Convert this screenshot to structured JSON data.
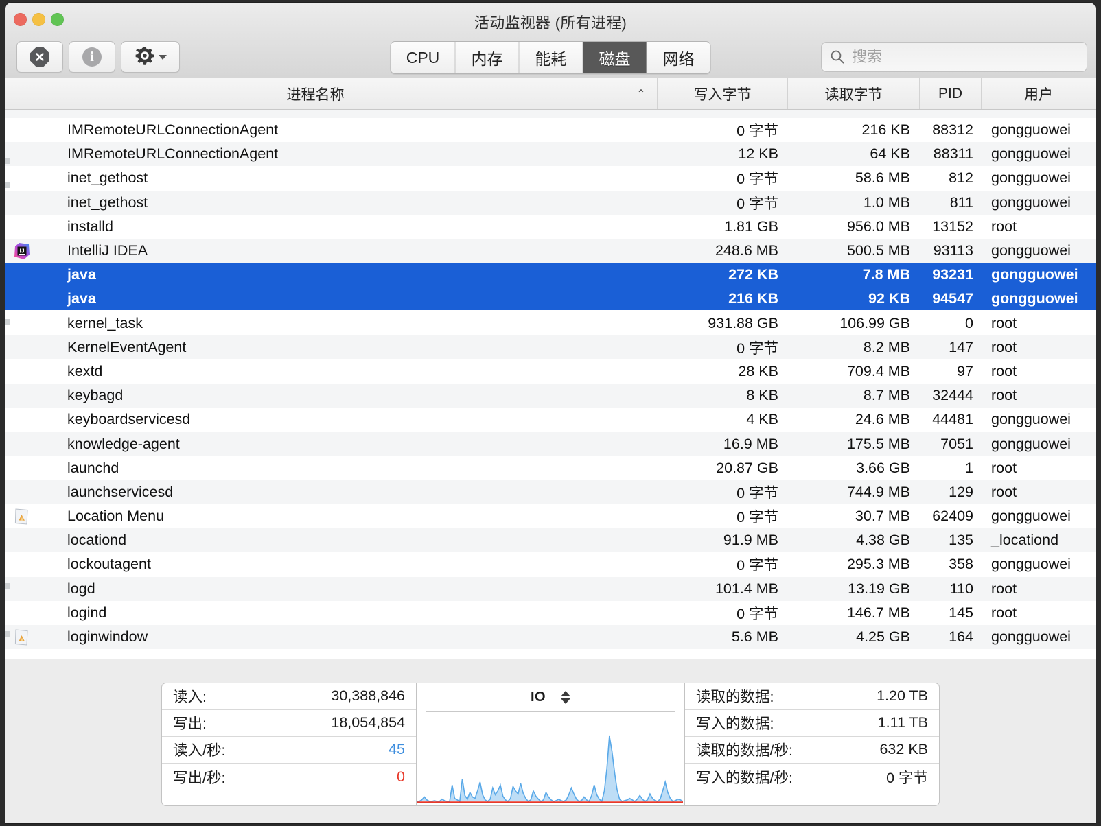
{
  "window": {
    "title": "活动监视器 (所有进程)",
    "traffic_lights": [
      "close",
      "minimize",
      "zoom"
    ]
  },
  "toolbar": {
    "quit_process_label": "quit-process",
    "inspect_label": "inspect",
    "gear_label": "view-options",
    "tabs": [
      {
        "label": "CPU",
        "active": false
      },
      {
        "label": "内存",
        "active": false
      },
      {
        "label": "能耗",
        "active": false
      },
      {
        "label": "磁盘",
        "active": true
      },
      {
        "label": "网络",
        "active": false
      }
    ],
    "search": {
      "placeholder": "搜索",
      "value": ""
    }
  },
  "columns": {
    "name": "进程名称",
    "sort_caret": "⌃",
    "write_bytes": "写入字节",
    "read_bytes": "读取字节",
    "pid": "PID",
    "user": "用户"
  },
  "rows": [
    {
      "name": "IMRemoteURLConnectionAgent",
      "write": "0 字节",
      "read": "216 KB",
      "pid": "88312",
      "user": "gongguowei",
      "icon": "",
      "selected": false
    },
    {
      "name": "IMRemoteURLConnectionAgent",
      "write": "12 KB",
      "read": "64 KB",
      "pid": "88311",
      "user": "gongguowei",
      "icon": "",
      "selected": false
    },
    {
      "name": "inet_gethost",
      "write": "0 字节",
      "read": "58.6 MB",
      "pid": "812",
      "user": "gongguowei",
      "icon": "",
      "selected": false
    },
    {
      "name": "inet_gethost",
      "write": "0 字节",
      "read": "1.0 MB",
      "pid": "811",
      "user": "gongguowei",
      "icon": "",
      "selected": false
    },
    {
      "name": "installd",
      "write": "1.81 GB",
      "read": "956.0 MB",
      "pid": "13152",
      "user": "root",
      "icon": "",
      "selected": false
    },
    {
      "name": "IntelliJ IDEA",
      "write": "248.6 MB",
      "read": "500.5 MB",
      "pid": "93113",
      "user": "gongguowei",
      "icon": "intellij-idea-icon",
      "selected": false
    },
    {
      "name": "java",
      "write": "272 KB",
      "read": "7.8 MB",
      "pid": "93231",
      "user": "gongguowei",
      "icon": "",
      "selected": true
    },
    {
      "name": "java",
      "write": "216 KB",
      "read": "92 KB",
      "pid": "94547",
      "user": "gongguowei",
      "icon": "",
      "selected": true
    },
    {
      "name": "kernel_task",
      "write": "931.88 GB",
      "read": "106.99 GB",
      "pid": "0",
      "user": "root",
      "icon": "",
      "selected": false
    },
    {
      "name": "KernelEventAgent",
      "write": "0 字节",
      "read": "8.2 MB",
      "pid": "147",
      "user": "root",
      "icon": "",
      "selected": false
    },
    {
      "name": "kextd",
      "write": "28 KB",
      "read": "709.4 MB",
      "pid": "97",
      "user": "root",
      "icon": "",
      "selected": false
    },
    {
      "name": "keybagd",
      "write": "8 KB",
      "read": "8.7 MB",
      "pid": "32444",
      "user": "root",
      "icon": "",
      "selected": false
    },
    {
      "name": "keyboardservicesd",
      "write": "4 KB",
      "read": "24.6 MB",
      "pid": "44481",
      "user": "gongguowei",
      "icon": "",
      "selected": false
    },
    {
      "name": "knowledge-agent",
      "write": "16.9 MB",
      "read": "175.5 MB",
      "pid": "7051",
      "user": "gongguowei",
      "icon": "",
      "selected": false
    },
    {
      "name": "launchd",
      "write": "20.87 GB",
      "read": "3.66 GB",
      "pid": "1",
      "user": "root",
      "icon": "",
      "selected": false
    },
    {
      "name": "launchservicesd",
      "write": "0 字节",
      "read": "744.9 MB",
      "pid": "129",
      "user": "root",
      "icon": "",
      "selected": false
    },
    {
      "name": "Location Menu",
      "write": "0 字节",
      "read": "30.7 MB",
      "pid": "62409",
      "user": "gongguowei",
      "icon": "document-sheet-icon",
      "selected": false
    },
    {
      "name": "locationd",
      "write": "91.9 MB",
      "read": "4.38 GB",
      "pid": "135",
      "user": "_locationd",
      "icon": "",
      "selected": false
    },
    {
      "name": "lockoutagent",
      "write": "0 字节",
      "read": "295.3 MB",
      "pid": "358",
      "user": "gongguowei",
      "icon": "",
      "selected": false
    },
    {
      "name": "logd",
      "write": "101.4 MB",
      "read": "13.19 GB",
      "pid": "110",
      "user": "root",
      "icon": "",
      "selected": false
    },
    {
      "name": "logind",
      "write": "0 字节",
      "read": "146.7 MB",
      "pid": "145",
      "user": "root",
      "icon": "",
      "selected": false
    },
    {
      "name": "loginwindow",
      "write": "5.6 MB",
      "read": "4.25 GB",
      "pid": "164",
      "user": "gongguowei",
      "icon": "document-sheet-icon",
      "selected": false
    }
  ],
  "footer": {
    "left_stats": [
      {
        "label": "读入:",
        "value": "30,388,846",
        "color": ""
      },
      {
        "label": "写出:",
        "value": "18,054,854",
        "color": ""
      },
      {
        "label": "读入/秒:",
        "value": "45",
        "color": "blue"
      },
      {
        "label": "写出/秒:",
        "value": "0",
        "color": "red"
      }
    ],
    "right_stats": [
      {
        "label": "读取的数据:",
        "value": "1.20 TB",
        "color": ""
      },
      {
        "label": "写入的数据:",
        "value": "1.11 TB",
        "color": ""
      },
      {
        "label": "读取的数据/秒:",
        "value": "632 KB",
        "color": ""
      },
      {
        "label": "写入的数据/秒:",
        "value": "0 字节",
        "color": ""
      }
    ],
    "graph": {
      "title": "IO",
      "series_color": "#5aa9e8",
      "fill_color": "#bcdcf5",
      "baseline_color": "#e8392a"
    }
  },
  "colors": {
    "selection_blue": "#1a5fd6",
    "tab_active_bg": "#585858",
    "accent_blue": "#3e8ede",
    "accent_red": "#e8392a"
  },
  "chart_data": {
    "type": "area",
    "title": "IO",
    "series": [
      {
        "name": "读入/秒",
        "color": "#5aa9e8",
        "values": [
          0,
          0,
          2,
          6,
          2,
          0,
          0,
          1,
          0,
          0,
          3,
          1,
          0,
          0,
          22,
          4,
          2,
          0,
          30,
          8,
          3,
          12,
          6,
          4,
          14,
          26,
          9,
          2,
          0,
          3,
          18,
          9,
          14,
          22,
          7,
          2,
          0,
          4,
          20,
          14,
          10,
          24,
          11,
          4,
          0,
          2,
          14,
          7,
          3,
          0,
          2,
          12,
          6,
          2,
          0,
          1,
          3,
          1,
          0,
          2,
          9,
          18,
          10,
          3,
          0,
          1,
          6,
          2,
          0,
          8,
          22,
          9,
          3,
          0,
          14,
          44,
          88,
          68,
          40,
          16,
          3,
          0,
          1,
          2,
          4,
          2,
          0,
          3,
          8,
          3,
          0,
          2,
          10,
          4,
          1,
          0,
          3,
          14,
          26,
          12,
          4,
          0,
          1,
          3,
          2,
          0
        ]
      },
      {
        "name": "写出/秒",
        "color": "#e8392a",
        "values": [
          0,
          0,
          0,
          0,
          0,
          0,
          0,
          0,
          0,
          0,
          0,
          0,
          0,
          0,
          0,
          0,
          0,
          0,
          0,
          0,
          0,
          0,
          0,
          0,
          0,
          0,
          0,
          0,
          0,
          0,
          0,
          0,
          0,
          0,
          0,
          0,
          0,
          0,
          0,
          0,
          0,
          0,
          0,
          0,
          0,
          0,
          0,
          0,
          0,
          0,
          0,
          0,
          0,
          0,
          0,
          0,
          0,
          0,
          0,
          0,
          0,
          0,
          0,
          0,
          0,
          0,
          0,
          0,
          0,
          0,
          0,
          0,
          0,
          0,
          0,
          0,
          0,
          0,
          0,
          0,
          0,
          0,
          0,
          0,
          0,
          0,
          0,
          0,
          0,
          0,
          0,
          0,
          0,
          0,
          0,
          0,
          0,
          0,
          0,
          0,
          0,
          0,
          0,
          0,
          0,
          0
        ]
      }
    ],
    "ylim": [
      0,
      100
    ],
    "grid": false,
    "legend": "none"
  }
}
